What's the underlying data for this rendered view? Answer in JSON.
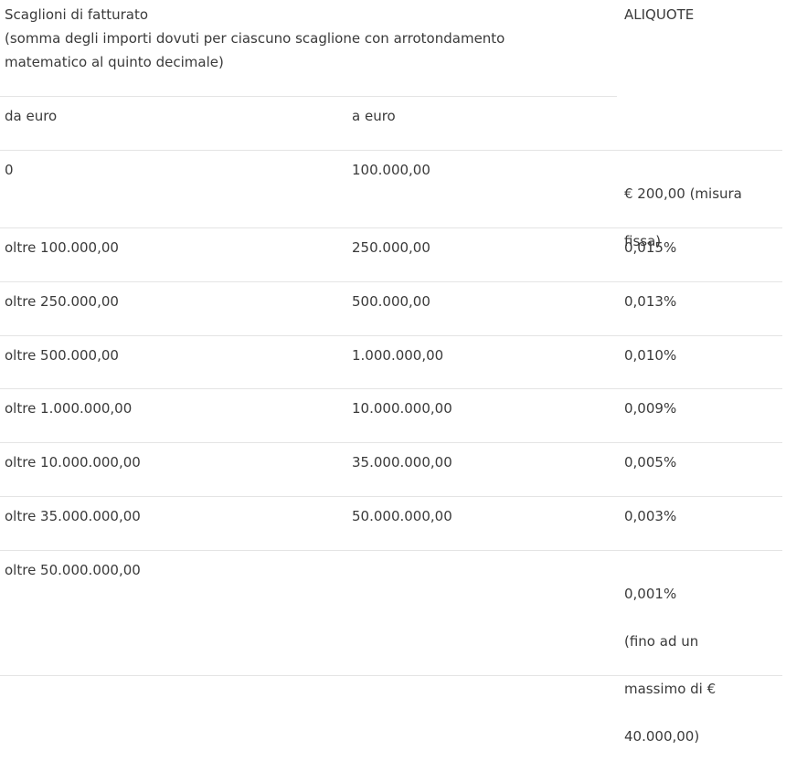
{
  "header": {
    "title": "Scaglioni di fatturato",
    "note_line1": "(somma degli importi dovuti per ciascuno scaglione con arrotondamento",
    "note_line2": "matematico al quinto decimale)",
    "aliquote": "ALIQUOTE",
    "col_from": "da euro",
    "col_to": "a euro"
  },
  "rows": [
    {
      "from": "0",
      "to": "100.000,00",
      "rate_line1": "€ 200,00 (misura",
      "rate_line2": "fissa)",
      "rate_line3": "",
      "rate_line4": ""
    },
    {
      "from": "oltre 100.000,00",
      "to": "250.000,00",
      "rate_line1": "0,015%",
      "rate_line2": "",
      "rate_line3": "",
      "rate_line4": ""
    },
    {
      "from": "oltre 250.000,00",
      "to": "500.000,00",
      "rate_line1": "0,013%",
      "rate_line2": "",
      "rate_line3": "",
      "rate_line4": ""
    },
    {
      "from": "oltre 500.000,00",
      "to": "1.000.000,00",
      "rate_line1": "0,010%",
      "rate_line2": "",
      "rate_line3": "",
      "rate_line4": ""
    },
    {
      "from": "oltre 1.000.000,00",
      "to": "10.000.000,00",
      "rate_line1": "0,009%",
      "rate_line2": "",
      "rate_line3": "",
      "rate_line4": ""
    },
    {
      "from": "oltre 10.000.000,00",
      "to": "35.000.000,00",
      "rate_line1": "0,005%",
      "rate_line2": "",
      "rate_line3": "",
      "rate_line4": ""
    },
    {
      "from": "oltre 35.000.000,00",
      "to": "50.000.000,00",
      "rate_line1": "0,003%",
      "rate_line2": "",
      "rate_line3": "",
      "rate_line4": ""
    },
    {
      "from": "oltre 50.000.000,00",
      "to": "",
      "rate_line1": "0,001%",
      "rate_line2": "(fino ad un",
      "rate_line3": "massimo di €",
      "rate_line4": "40.000,00)"
    }
  ]
}
